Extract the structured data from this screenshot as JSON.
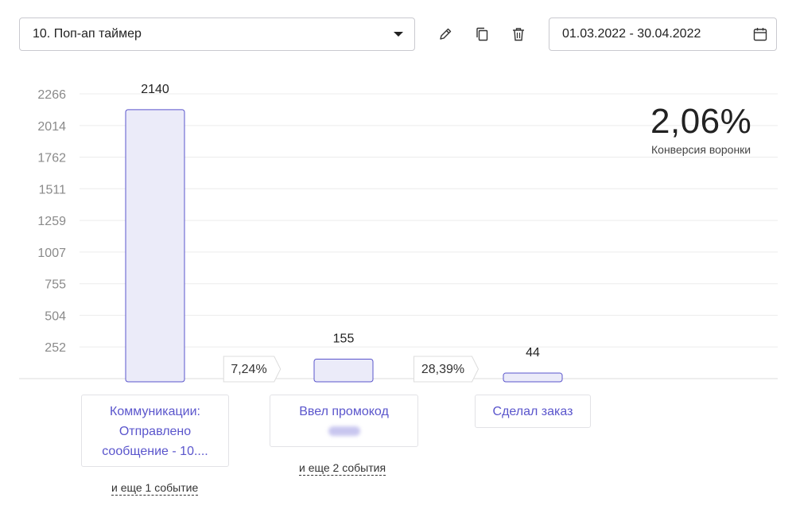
{
  "toolbar": {
    "funnel_select_value": "10. Поп-ап таймер",
    "edit_icon": "pencil-icon",
    "copy_icon": "copy-icon",
    "delete_icon": "trash-icon",
    "date_range": "01.03.2022 - 30.04.2022",
    "calendar_icon": "calendar-icon"
  },
  "kpi": {
    "value": "2,06%",
    "label": "Конверсия воронки"
  },
  "chart_data": {
    "type": "bar",
    "categories": [
      "Коммуникации: Отправлено сообщение - 10....",
      "Ввел промокод",
      "Сделал заказ"
    ],
    "values": [
      2140,
      155,
      44
    ],
    "value_labels": [
      "2140",
      "155",
      "44"
    ],
    "y_ticks": [
      "252",
      "504",
      "755",
      "1007",
      "1259",
      "1511",
      "1762",
      "2014",
      "2266"
    ],
    "y_tick_values": [
      252,
      504,
      755,
      1007,
      1259,
      1511,
      1762,
      2014,
      2266
    ],
    "ylim": [
      0,
      2266
    ],
    "grid": true,
    "conversion_labels": [
      "7,24%",
      "28,39%"
    ],
    "colors": {
      "bar_fill": "#ebebf9",
      "bar_stroke": "#5a55cc",
      "grid": "#ececec",
      "axis_text": "#8a8a8a"
    }
  },
  "steps": [
    {
      "line1": "Коммуникации:",
      "line2": "Отправлено",
      "line3": "сообщение - 10....",
      "more": "и еще 1 событие"
    },
    {
      "line1": "Ввел промокод",
      "more": "и еще 2 события"
    },
    {
      "line1": "Сделал заказ"
    }
  ]
}
